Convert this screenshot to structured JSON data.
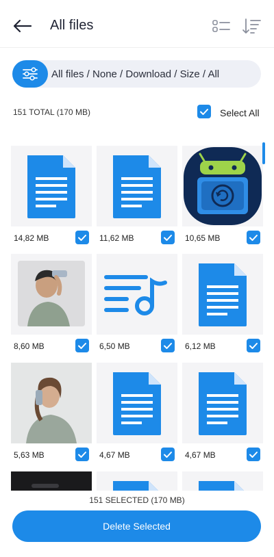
{
  "header": {
    "title": "All files"
  },
  "filter": {
    "path": "All files / None / Download / Size / All"
  },
  "summary": {
    "total": "151 TOTAL (170 MB)",
    "select_all": "Select All"
  },
  "files": [
    {
      "size": "14,82 MB",
      "type": "document-icon",
      "checked": true
    },
    {
      "size": "11,62 MB",
      "type": "document-icon",
      "checked": true
    },
    {
      "size": "10,65 MB",
      "type": "android-app-icon",
      "checked": true
    },
    {
      "size": "8,60 MB",
      "type": "photo-person-phone",
      "checked": true
    },
    {
      "size": "6,50 MB",
      "type": "audio-icon",
      "checked": true
    },
    {
      "size": "6,12 MB",
      "type": "document-icon",
      "checked": true
    },
    {
      "size": "5,63 MB",
      "type": "photo-person-phone",
      "checked": true
    },
    {
      "size": "4,67 MB",
      "type": "document-icon",
      "checked": true
    },
    {
      "size": "4,67 MB",
      "type": "document-icon",
      "checked": true
    }
  ],
  "footer": {
    "selected": "151 SELECTED (170 MB)",
    "delete_label": "Delete Selected"
  },
  "colors": {
    "accent": "#1d8ae8",
    "tile_bg": "#f4f4f6",
    "filter_bg": "#eef0f6"
  }
}
